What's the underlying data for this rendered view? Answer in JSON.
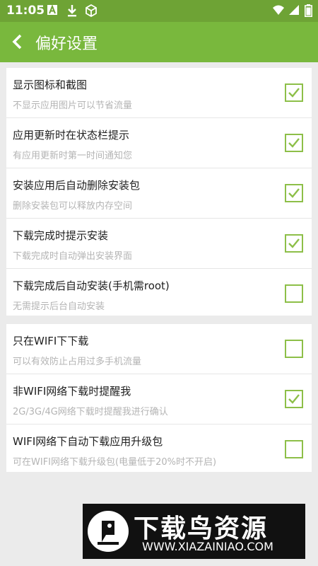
{
  "status_bar": {
    "time": "11:05",
    "icons": [
      "a-notification-icon",
      "download-icon",
      "box-icon",
      "wifi-icon",
      "signal-icon",
      "battery-icon"
    ]
  },
  "header": {
    "title": "偏好设置",
    "back_icon": "back-arrow-icon"
  },
  "group1": [
    {
      "title": "显示图标和截图",
      "subtitle": "不显示应用图片可以节省流量",
      "checked": true
    },
    {
      "title": "应用更新时在状态栏提示",
      "subtitle": "有应用更新时第一时间通知您",
      "checked": true
    },
    {
      "title": "安装应用后自动删除安装包",
      "subtitle": "删除安装包可以释放内存空间",
      "checked": true
    },
    {
      "title": "下载完成时提示安装",
      "subtitle": "下载完成时自动弹出安装界面",
      "checked": true
    },
    {
      "title": "下载完成后自动安装(手机需root)",
      "subtitle": "无需提示后台自动安装",
      "checked": false
    }
  ],
  "group2": [
    {
      "title": "只在WIFI下下载",
      "subtitle": "可以有效防止占用过多手机流量",
      "checked": false
    },
    {
      "title": "非WIFI网络下载时提醒我",
      "subtitle": "2G/3G/4G网络下载时提醒我进行确认",
      "checked": true
    },
    {
      "title": "WIFI网络下自动下载应用升级包",
      "subtitle": "可在WIFI网络下载升级包(电量低于20%时不开启)",
      "checked": false
    }
  ],
  "watermark": {
    "title": "下载鸟资源",
    "url": "WWW.XIAZAINIAO.COM"
  },
  "colors": {
    "status": "#6ea335",
    "appbar": "#79b83d",
    "check": "#8dbf48",
    "background": "#ebebeb"
  }
}
